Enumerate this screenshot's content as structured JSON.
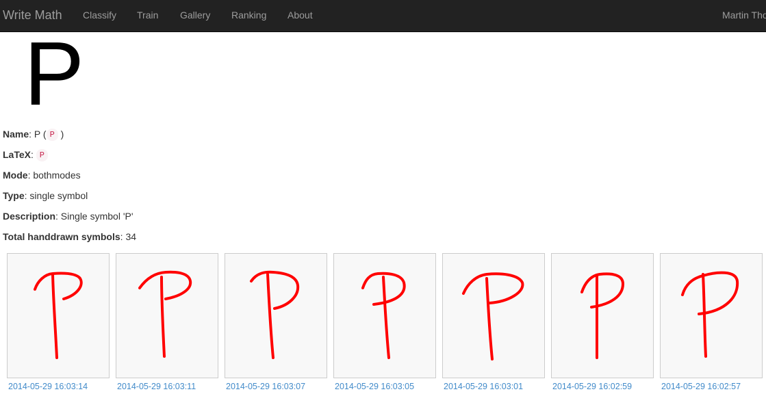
{
  "navbar": {
    "brand": "Write Math",
    "items": [
      {
        "label": "Classify"
      },
      {
        "label": "Train"
      },
      {
        "label": "Gallery"
      },
      {
        "label": "Ranking"
      },
      {
        "label": "About"
      }
    ],
    "user": "Martin Thoma"
  },
  "symbol": {
    "display": "P",
    "fields": [
      {
        "label": "Name",
        "value_before": "P (",
        "badge": "P",
        "value_after": ")"
      },
      {
        "label": "LaTeX",
        "value_before": "",
        "badge": "P",
        "value_after": ""
      },
      {
        "label": "Mode",
        "value_before": "bothmodes",
        "badge": "",
        "value_after": ""
      },
      {
        "label": "Type",
        "value_before": "single symbol",
        "badge": "",
        "value_after": ""
      },
      {
        "label": "Description",
        "value_before": "Single symbol 'P'",
        "badge": "",
        "value_after": ""
      },
      {
        "label": "Total handdrawn symbols",
        "value_before": "34",
        "badge": "",
        "value_after": ""
      }
    ]
  },
  "drawings": [
    {
      "date": "2014-05-29 16:03:14"
    },
    {
      "date": "2014-05-29 16:03:11"
    },
    {
      "date": "2014-05-29 16:03:07"
    },
    {
      "date": "2014-05-29 16:03:05"
    },
    {
      "date": "2014-05-29 16:03:01"
    },
    {
      "date": "2014-05-29 16:02:59"
    },
    {
      "date": "2014-05-29 16:02:57"
    }
  ],
  "colors": {
    "navbar_bg": "#222222",
    "nav_text": "#9d9d9d",
    "link": "#428bca",
    "stroke": "#ff0000",
    "badge_text": "#c7254e",
    "badge_bg": "#f9f2f4"
  },
  "icons": {
    "drawing": "handdrawn-p-drawing"
  }
}
